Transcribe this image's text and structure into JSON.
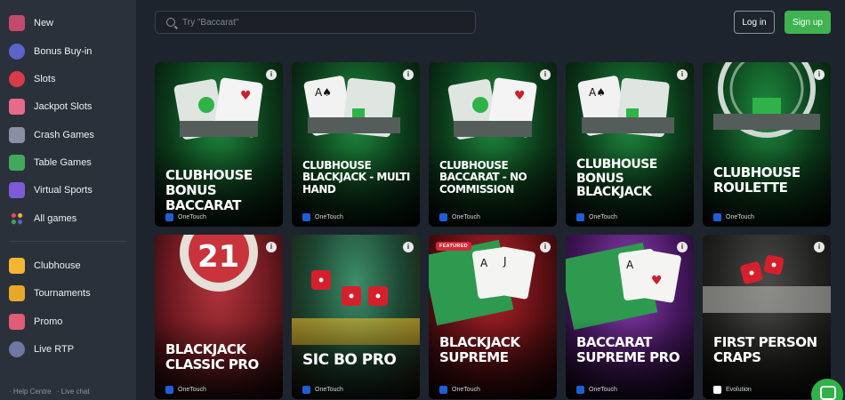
{
  "sidebar": {
    "items": [
      {
        "label": "New",
        "icon": "gift-icon",
        "color": "#c44a6c"
      },
      {
        "label": "Bonus Buy-in",
        "icon": "coin-icon",
        "color": "#f0b93a"
      },
      {
        "label": "Slots",
        "icon": "cherry-icon",
        "color": "#d93b4a"
      },
      {
        "label": "Jackpot Slots",
        "icon": "jackpot-icon",
        "color": "#e56a8b"
      },
      {
        "label": "Crash Games",
        "icon": "rocket-icon",
        "color": "#8a8fa3"
      },
      {
        "label": "Table Games",
        "icon": "table-icon",
        "color": "#41a85c"
      },
      {
        "label": "Virtual Sports",
        "icon": "gamepad-icon",
        "color": "#7e5ad6"
      },
      {
        "label": "All games",
        "icon": "grid-dots-icon",
        "color": "#e94d5c"
      }
    ],
    "secondary": [
      {
        "label": "Clubhouse",
        "icon": "crown-icon",
        "color": "#f2b632"
      },
      {
        "label": "Tournaments",
        "icon": "trophy-icon",
        "color": "#e8a92a"
      },
      {
        "label": "Promo",
        "icon": "megaphone-icon",
        "color": "#e25b77"
      },
      {
        "label": "Live RTP",
        "icon": "gauge-icon",
        "color": "#6f78a0"
      }
    ],
    "footer": {
      "help": "· Help Centre",
      "chat": "· Live chat"
    }
  },
  "header": {
    "search_placeholder": "Try \"Baccarat\"",
    "login_label": "Log in",
    "signup_label": "Sign up"
  },
  "games": [
    {
      "title": "Clubhouse Bonus Baccarat",
      "provider": "OneTouch",
      "theme": "green"
    },
    {
      "title": "Clubhouse Blackjack - Multi Hand",
      "provider": "OneTouch",
      "theme": "green"
    },
    {
      "title": "Clubhouse Baccarat - No Commission",
      "provider": "OneTouch",
      "theme": "green"
    },
    {
      "title": "Clubhouse Bonus Blackjack",
      "provider": "OneTouch",
      "theme": "green"
    },
    {
      "title": "Clubhouse Roulette",
      "provider": "OneTouch",
      "theme": "green"
    },
    {
      "title": "Blackjack Classic Pro",
      "provider": "OneTouch",
      "theme": "red"
    },
    {
      "title": "Sic Bo Pro",
      "provider": "OneTouch",
      "theme": "gold"
    },
    {
      "title": "Blackjack Supreme",
      "provider": "OneTouch",
      "theme": "crimson",
      "badge": "FEATURED"
    },
    {
      "title": "Baccarat Supreme Pro",
      "provider": "OneTouch",
      "theme": "purple"
    },
    {
      "title": "First Person Craps",
      "provider": "Evolution",
      "theme": "dark"
    }
  ],
  "info_glyph": "i"
}
